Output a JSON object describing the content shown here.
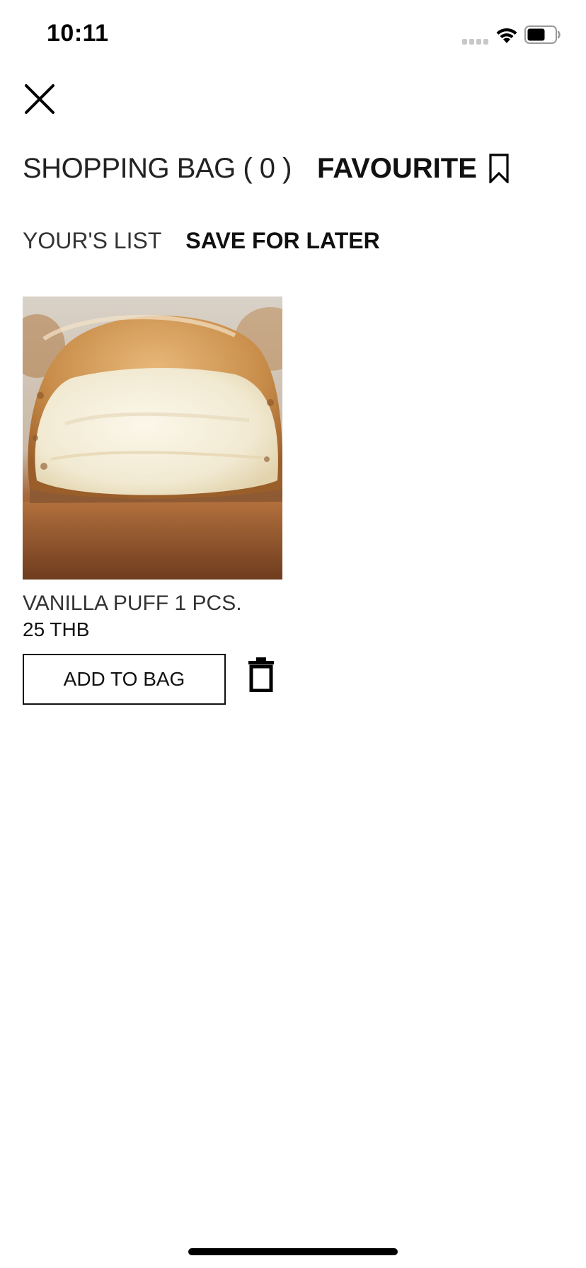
{
  "status_bar": {
    "time": "10:11"
  },
  "header": {
    "close_icon": "close-icon"
  },
  "tabs": {
    "shopping_bag_label": "SHOPPING BAG ( 0 )",
    "favourite_label": "FAVOURITE",
    "favourite_icon": "bookmark-icon"
  },
  "sub_tabs": {
    "yours_list_label": "YOUR'S LIST",
    "save_for_later_label": "SAVE FOR LATER"
  },
  "product": {
    "name": "VANILLA PUFF 1 PCS.",
    "price": "25 THB",
    "add_to_bag_label": "ADD TO BAG",
    "delete_icon": "trash-icon"
  }
}
